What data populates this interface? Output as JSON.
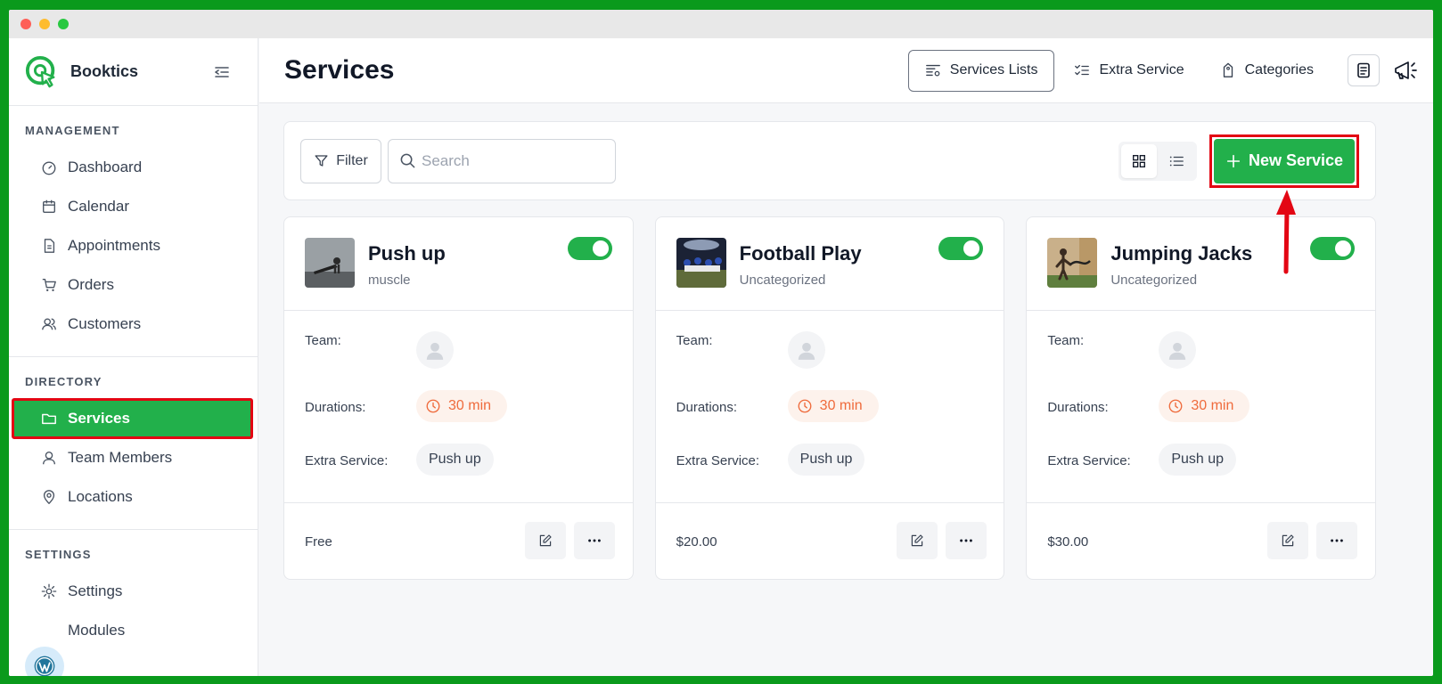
{
  "colors": {
    "accent": "#22b04b",
    "highlight": "#e30613",
    "duration": "#ef6b3c"
  },
  "brand": {
    "name": "Booktics"
  },
  "sidebar": {
    "management_title": "MANAGEMENT",
    "management": [
      "Dashboard",
      "Calendar",
      "Appointments",
      "Orders",
      "Customers"
    ],
    "directory_title": "DIRECTORY",
    "directory": [
      "Services",
      "Team Members",
      "Locations"
    ],
    "settings_title": "SETTINGS",
    "settings": [
      "Settings",
      "Modules"
    ]
  },
  "header": {
    "title": "Services",
    "tabs": [
      "Services Lists",
      "Extra Service",
      "Categories"
    ]
  },
  "toolbar": {
    "filter_label": "Filter",
    "search_placeholder": "Search",
    "new_label": "New Service"
  },
  "labels": {
    "team": "Team:",
    "durations": "Durations:",
    "extra": "Extra Service:"
  },
  "services": [
    {
      "title": "Push up",
      "category": "muscle",
      "duration": "30 min",
      "extra": "Push up",
      "price": "Free",
      "enabled": true
    },
    {
      "title": "Football Play",
      "category": "Uncategorized",
      "duration": "30 min",
      "extra": "Push up",
      "price": "$20.00",
      "enabled": true
    },
    {
      "title": "Jumping Jacks",
      "category": "Uncategorized",
      "duration": "30 min",
      "extra": "Push up",
      "price": "$30.00",
      "enabled": true
    }
  ]
}
